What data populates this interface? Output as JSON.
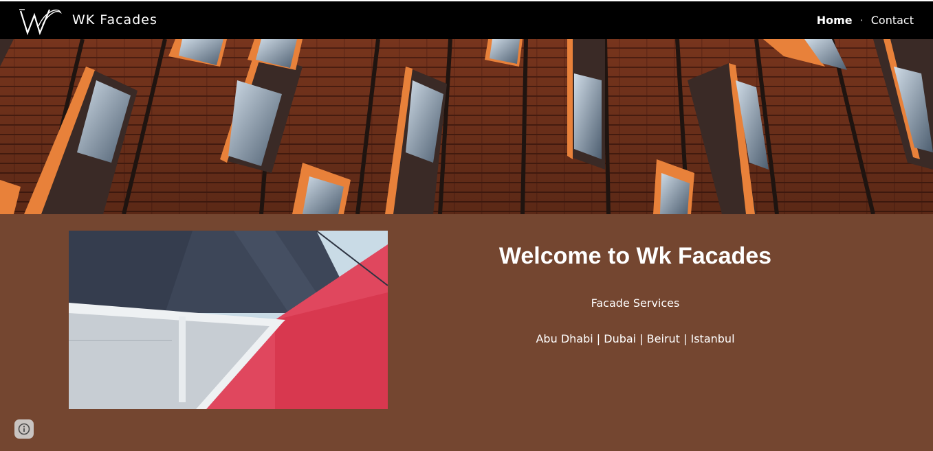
{
  "header": {
    "brand": "WK Facades",
    "nav": [
      {
        "label": "Home",
        "active": true
      },
      {
        "label": "Contact",
        "active": false
      }
    ],
    "separator": "·"
  },
  "main": {
    "heading": "Welcome to Wk Facades",
    "subheading": "Facade Services",
    "locations": "Abu Dhabi | Dubai | Beirut | Istanbul"
  },
  "icons": {
    "logo": "wk-logo",
    "info": "info-icon"
  },
  "colors": {
    "header_bg": "#000000",
    "section_bg": "#744630",
    "text": "#ffffff"
  }
}
